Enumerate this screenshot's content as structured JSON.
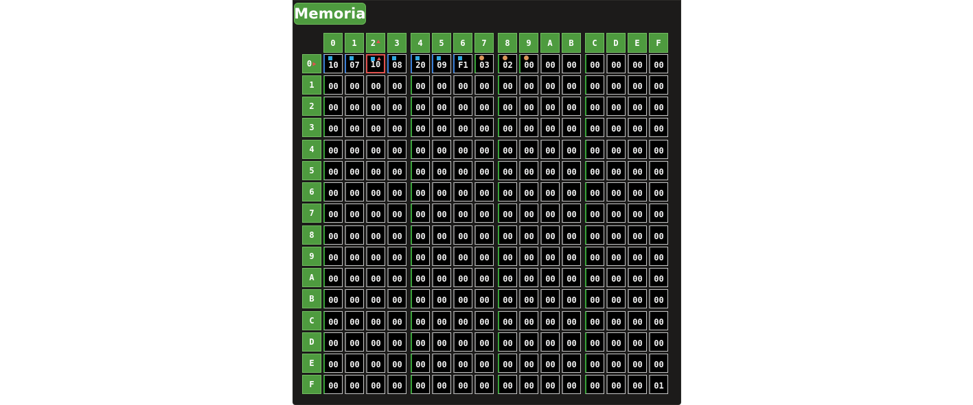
{
  "title": "Memoria",
  "col_headers": [
    "0",
    "1",
    "2",
    "3",
    "4",
    "5",
    "6",
    "7",
    "8",
    "9",
    "A",
    "B",
    "C",
    "D",
    "E",
    "F"
  ],
  "row_headers": [
    "0",
    "1",
    "2",
    "3",
    "4",
    "5",
    "6",
    "7",
    "8",
    "9",
    "A",
    "B",
    "C",
    "D",
    "E",
    "F"
  ],
  "selected_col": "2",
  "selected_row": "0",
  "memory": [
    [
      "10",
      "07",
      "10",
      "08",
      "20",
      "09",
      "F1",
      "03",
      "02",
      "00",
      "00",
      "00",
      "00",
      "00",
      "00",
      "00"
    ],
    [
      "00",
      "00",
      "00",
      "00",
      "00",
      "00",
      "00",
      "00",
      "00",
      "00",
      "00",
      "00",
      "00",
      "00",
      "00",
      "00"
    ],
    [
      "00",
      "00",
      "00",
      "00",
      "00",
      "00",
      "00",
      "00",
      "00",
      "00",
      "00",
      "00",
      "00",
      "00",
      "00",
      "00"
    ],
    [
      "00",
      "00",
      "00",
      "00",
      "00",
      "00",
      "00",
      "00",
      "00",
      "00",
      "00",
      "00",
      "00",
      "00",
      "00",
      "00"
    ],
    [
      "00",
      "00",
      "00",
      "00",
      "00",
      "00",
      "00",
      "00",
      "00",
      "00",
      "00",
      "00",
      "00",
      "00",
      "00",
      "00"
    ],
    [
      "00",
      "00",
      "00",
      "00",
      "00",
      "00",
      "00",
      "00",
      "00",
      "00",
      "00",
      "00",
      "00",
      "00",
      "00",
      "00"
    ],
    [
      "00",
      "00",
      "00",
      "00",
      "00",
      "00",
      "00",
      "00",
      "00",
      "00",
      "00",
      "00",
      "00",
      "00",
      "00",
      "00"
    ],
    [
      "00",
      "00",
      "00",
      "00",
      "00",
      "00",
      "00",
      "00",
      "00",
      "00",
      "00",
      "00",
      "00",
      "00",
      "00",
      "00"
    ],
    [
      "00",
      "00",
      "00",
      "00",
      "00",
      "00",
      "00",
      "00",
      "00",
      "00",
      "00",
      "00",
      "00",
      "00",
      "00",
      "00"
    ],
    [
      "00",
      "00",
      "00",
      "00",
      "00",
      "00",
      "00",
      "00",
      "00",
      "00",
      "00",
      "00",
      "00",
      "00",
      "00",
      "00"
    ],
    [
      "00",
      "00",
      "00",
      "00",
      "00",
      "00",
      "00",
      "00",
      "00",
      "00",
      "00",
      "00",
      "00",
      "00",
      "00",
      "00"
    ],
    [
      "00",
      "00",
      "00",
      "00",
      "00",
      "00",
      "00",
      "00",
      "00",
      "00",
      "00",
      "00",
      "00",
      "00",
      "00",
      "00"
    ],
    [
      "00",
      "00",
      "00",
      "00",
      "00",
      "00",
      "00",
      "00",
      "00",
      "00",
      "00",
      "00",
      "00",
      "00",
      "00",
      "00"
    ],
    [
      "00",
      "00",
      "00",
      "00",
      "00",
      "00",
      "00",
      "00",
      "00",
      "00",
      "00",
      "00",
      "00",
      "00",
      "00",
      "00"
    ],
    [
      "00",
      "00",
      "00",
      "00",
      "00",
      "00",
      "00",
      "00",
      "00",
      "00",
      "00",
      "00",
      "00",
      "00",
      "00",
      "00"
    ],
    [
      "00",
      "00",
      "00",
      "00",
      "00",
      "00",
      "00",
      "00",
      "00",
      "00",
      "00",
      "00",
      "00",
      "00",
      "00",
      "01"
    ]
  ],
  "row0_markers": [
    "square",
    "square",
    "square",
    "square",
    "square",
    "square",
    "square",
    "dot",
    "dot",
    "dot",
    "",
    "",
    "",
    "",
    "",
    ""
  ],
  "row0_edge_colors": [
    "blue",
    "blue",
    "blue",
    "blue",
    "blue",
    "blue",
    "blue",
    "green",
    "green",
    "green",
    "",
    "",
    "",
    "",
    "",
    ""
  ],
  "marker_colors": {
    "square": "#33a8e0",
    "dot": "#d9965b",
    "selected": "#e0524f"
  },
  "colors": {
    "header_green": "#4e9b3f",
    "panel": "#1c1b1a",
    "cell": "#000000"
  }
}
